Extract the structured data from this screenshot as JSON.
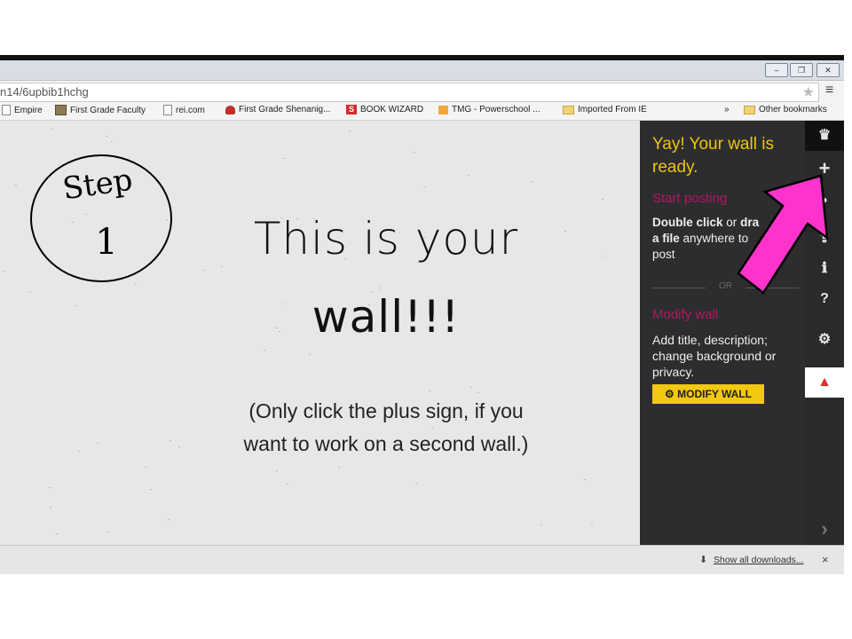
{
  "browser": {
    "url": "n14/6upbib1hchg",
    "window_buttons": [
      "–",
      "❐",
      "✕"
    ],
    "bookmarks": [
      {
        "label": "Empire",
        "icon": "page-icon"
      },
      {
        "label": "First Grade Faculty",
        "icon": "photo-icon"
      },
      {
        "label": "rei.com",
        "icon": "page-icon"
      },
      {
        "label": "First Grade Shenanig...",
        "icon": "ladybug-icon"
      },
      {
        "label": "BOOK WIZARD",
        "icon": "s-logo-icon"
      },
      {
        "label": "TMG - Powerschool ...",
        "icon": "tmg-icon"
      },
      {
        "label": "Imported From IE",
        "icon": "folder-icon"
      }
    ],
    "overflow": "»",
    "other_bookmarks": "Other bookmarks"
  },
  "wall": {
    "step_word": "Step",
    "step_number": "1",
    "line1": "This is your",
    "line2": "wall!!!",
    "note_line1": "(Only click the plus sign, if you",
    "note_line2": "want to work on a second wall.)"
  },
  "panel": {
    "heading": "Yay! Your wall is ready.",
    "start_posting": "Start posting",
    "instr_bold1": "Double click",
    "instr_or": "or",
    "instr_bold2": "dra",
    "instr_bold3": "a file",
    "instr_rest": "anywhere to",
    "instr_end": "post",
    "or_label": "OR",
    "modify_heading": "Modify wall",
    "modify_desc": "Add title, description; change background or privacy.",
    "modify_button": "MODIFY WALL"
  },
  "iconbar": [
    {
      "name": "crown-icon",
      "glyph": "♛"
    },
    {
      "name": "plus-icon",
      "glyph": "+"
    },
    {
      "name": "person-icon",
      "glyph": "●"
    },
    {
      "name": "share-icon",
      "glyph": "⇪"
    },
    {
      "name": "info-icon",
      "glyph": "ℹ"
    },
    {
      "name": "help-icon",
      "glyph": "?"
    },
    {
      "name": "gear-icon",
      "glyph": "⚙"
    },
    {
      "name": "alert-icon",
      "glyph": "▲"
    },
    {
      "name": "chevron-right-icon",
      "glyph": "›"
    }
  ],
  "downloads": {
    "link": "Show all downloads...",
    "close": "×"
  },
  "colors": {
    "panel_bg": "#2d2d30",
    "heading_yellow": "#f1c40f",
    "subhead_magenta": "#b2185f",
    "button_yellow": "#f2c811",
    "arrow_pink": "#ff33cc"
  }
}
